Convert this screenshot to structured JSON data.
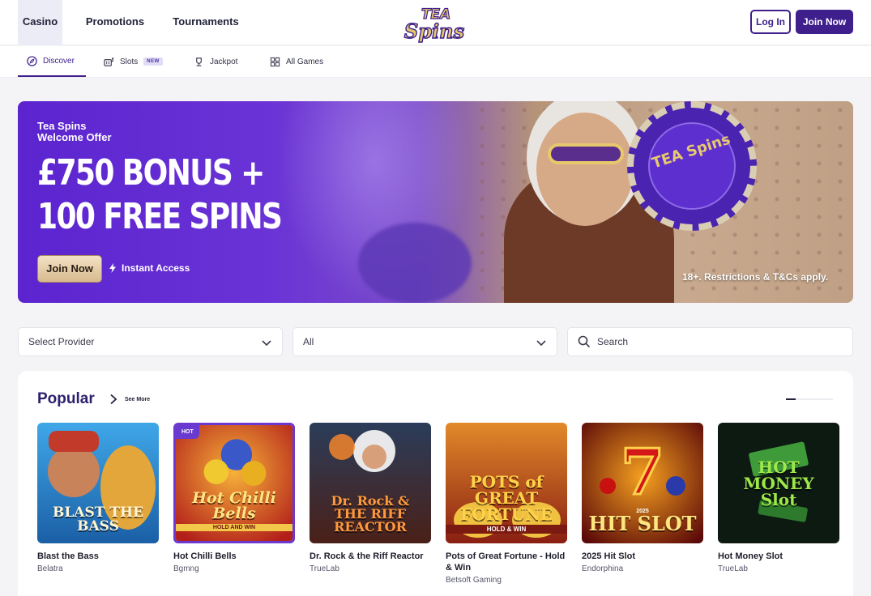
{
  "header": {
    "tabs": [
      {
        "label": "Casino",
        "active": true
      },
      {
        "label": "Promotions",
        "active": false
      },
      {
        "label": "Tournaments",
        "active": false
      }
    ],
    "logo_text": "TEA Spins",
    "login_label": "Log In",
    "join_label": "Join Now"
  },
  "subnav": {
    "items": [
      {
        "label": "Discover",
        "icon": "compass-icon",
        "active": true
      },
      {
        "label": "Slots",
        "icon": "slot-machine-icon",
        "badge": "NEW"
      },
      {
        "label": "Jackpot",
        "icon": "trophy-icon"
      },
      {
        "label": "All Games",
        "icon": "grid-icon"
      }
    ]
  },
  "hero": {
    "kicker_line1": "Tea Spins",
    "kicker_line2": "Welcome Offer",
    "headline_line1": "£750 BONUS +",
    "headline_line2": "100 FREE SPINS",
    "cta_label": "Join Now",
    "instant_label": "Instant Access",
    "disclaimer": "18+. Restrictions & T&Cs apply.",
    "chip_text": "TEA Spins"
  },
  "filters": {
    "provider_placeholder": "Select Provider",
    "category_value": "All",
    "search_placeholder": "Search"
  },
  "popular": {
    "title": "Popular",
    "see_more": "See More",
    "games": [
      {
        "name": "Blast the Bass",
        "provider": "Belatra",
        "art_title": "BLAST THE BASS",
        "hot": false
      },
      {
        "name": "Hot Chilli Bells",
        "provider": "Bgmng",
        "art_title": "Hot Chilli Bells",
        "art_sub": "HOLD AND WIN",
        "hot": true,
        "hot_label": "HOT"
      },
      {
        "name": "Dr. Rock & the Riff Reactor",
        "provider": "TrueLab",
        "art_title": "Dr. Rock & THE RIFF REACTOR",
        "hot": false
      },
      {
        "name": "Pots of Great Fortune - Hold & Win",
        "provider": "Betsoft Gaming",
        "art_title": "POTS of GREAT FORTUNE",
        "art_sub": "HOLD & WIN",
        "hot": false
      },
      {
        "name": "2025 Hit Slot",
        "provider": "Endorphina",
        "art_title": "HIT SLOT",
        "art_year": "2025",
        "hot": false
      },
      {
        "name": "Hot Money Slot",
        "provider": "TrueLab",
        "art_title": "HOT MONEY Slot",
        "hot": false
      }
    ]
  },
  "colors": {
    "brand_purple": "#3e1f8c",
    "accent_purple": "#6a3ad0",
    "gold": "#e7c86c"
  }
}
